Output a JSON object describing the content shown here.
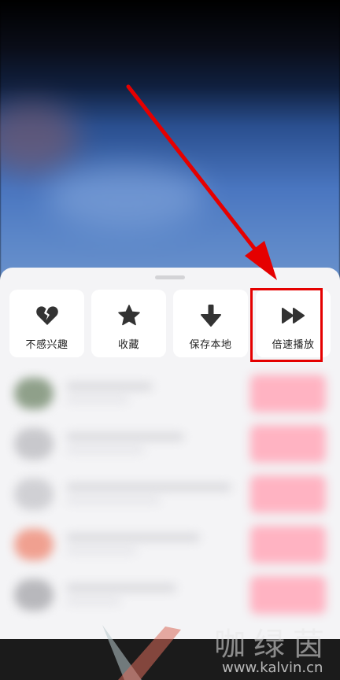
{
  "actions": [
    {
      "label": "不感兴趣",
      "icon": "broken-heart-icon"
    },
    {
      "label": "收藏",
      "icon": "star-icon"
    },
    {
      "label": "保存本地",
      "icon": "download-arrow-icon"
    },
    {
      "label": "倍速播放",
      "icon": "fast-forward-icon"
    }
  ],
  "watermark": {
    "brand": "咖绿茵",
    "url": "www.kalvin.cn"
  },
  "colors": {
    "highlight": "#e50000",
    "sheet_bg": "#f4f4f6",
    "icon": "#333333"
  }
}
